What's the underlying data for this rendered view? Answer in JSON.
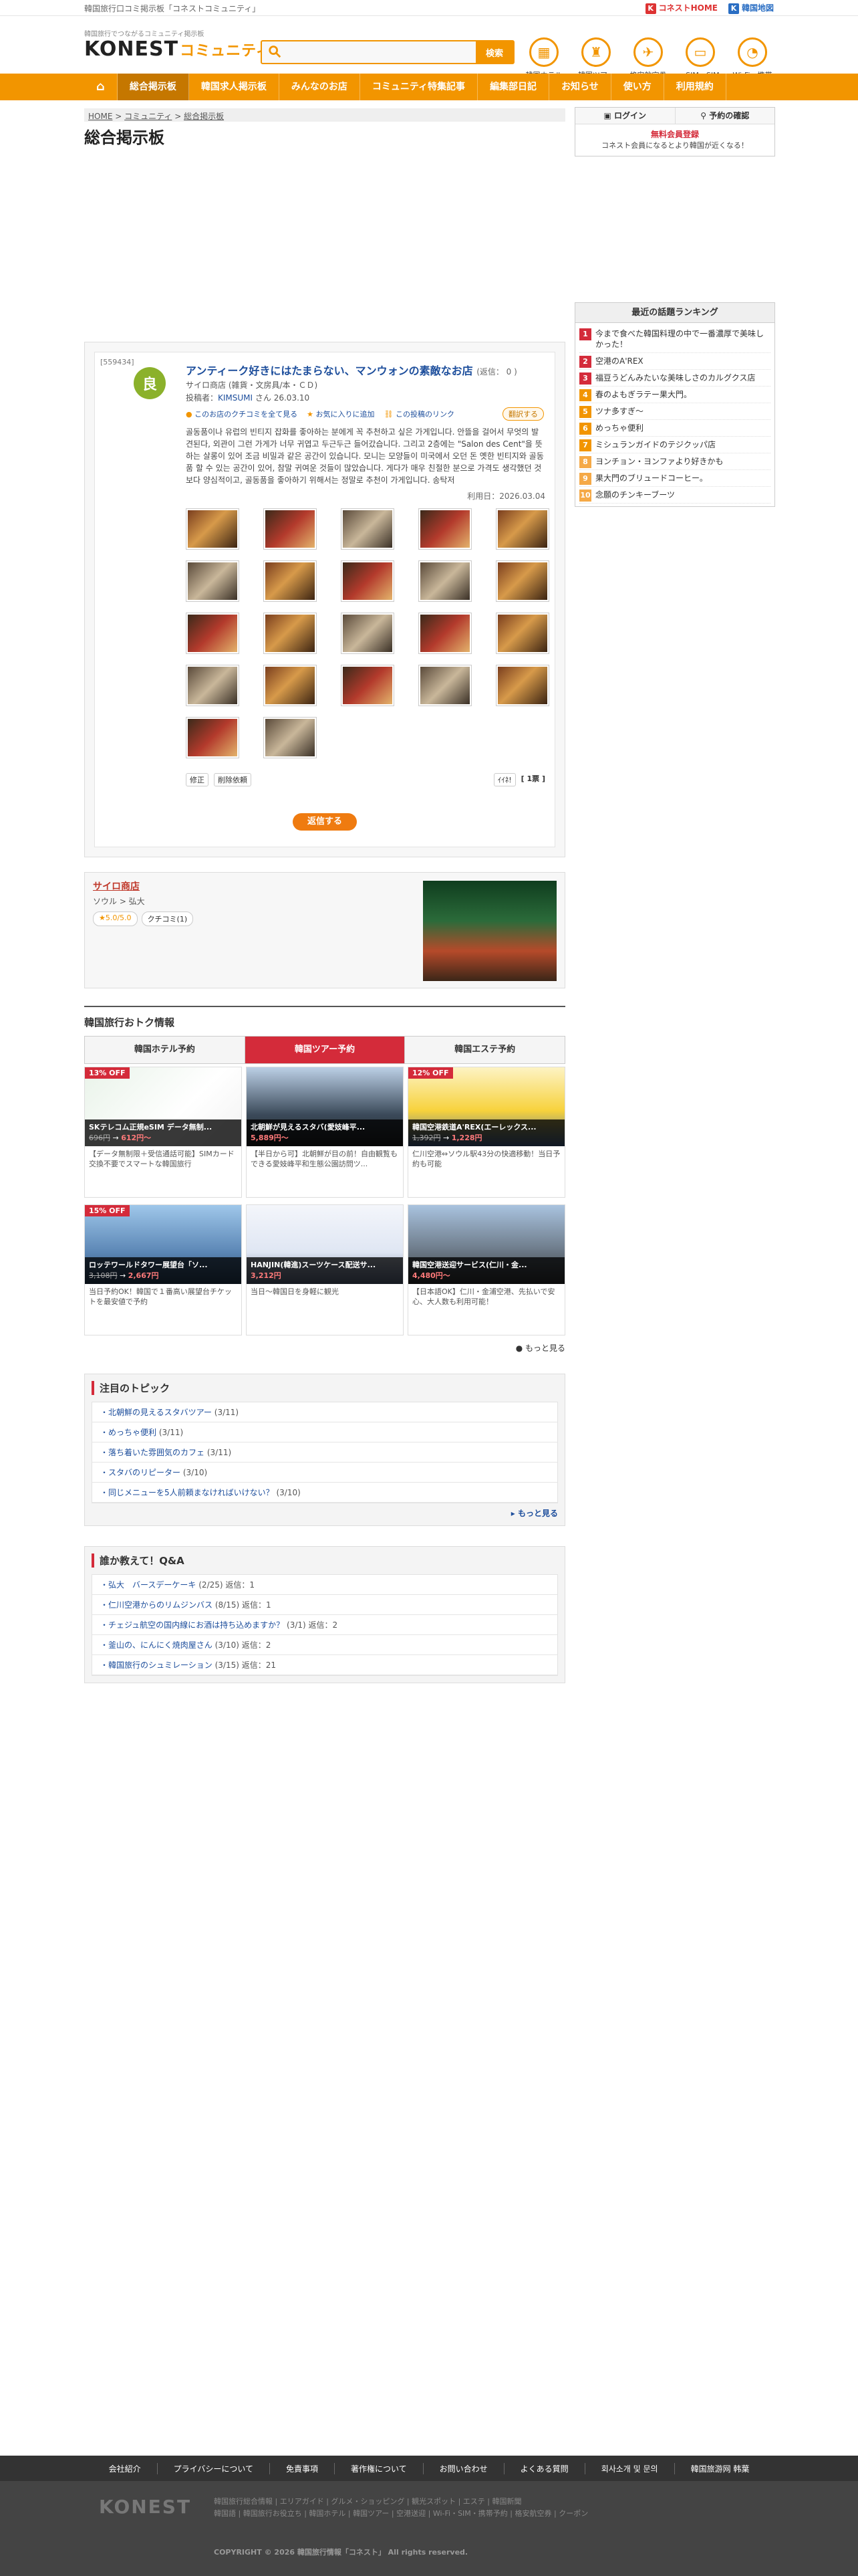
{
  "topbar": {
    "site_caption": "韓国旅行口コミ掲示板「コネストコミュニティ」",
    "link_konest": "コネストHOME",
    "link_map": "韓国地図"
  },
  "header": {
    "logo_tagline": "韓国旅行でつながるコミュニティ掲示板",
    "logo_main": "KONEST",
    "logo_sub": "コミュニティ",
    "search_placeholder": "",
    "search_button": "検索",
    "quick_links": [
      "韓国ホテル",
      "韓国ツアー",
      "格安航空券",
      "eSIM・SIM",
      "Wi-Fi・携帯"
    ]
  },
  "gnav": {
    "items": [
      "総合掲示板",
      "韓国求人掲示板",
      "みんなのお店",
      "コミュニティ特集記事",
      "編集部日記",
      "お知らせ",
      "使い方",
      "利用規約"
    ]
  },
  "breadcrumb": {
    "home": "HOME",
    "community": "コミュニティ",
    "current": "総合掲示板"
  },
  "page_title": "総合掲示板",
  "post": {
    "id": "[559434]",
    "grade": "良",
    "title": "アンティーク好きにはたまらない、マンウォンの素敵なお店",
    "reply_label": "(返信： 0 )",
    "shop_line": "サイロ商店 (雑貨・文房具/本・ＣＤ)",
    "poster_prefix": "投稿者：",
    "poster_name": "KIMSUMI",
    "poster_suffix": "さん 26.03.10",
    "action_all": "このお店のクチコミを全て見る",
    "action_fav": "お気に入りに追加",
    "action_url": "この投稿のリンク",
    "translate": "翻訳する",
    "body": "골동품이나 유럽의 빈티지 잡화를 좋아하는 분에게 꼭 추천하고 싶은 가게입니다. 안뜰을 걸어서 무엇의 발견된다, 외관이 그런 가게가 너무 귀엽고 두근두근 들어갔습니다. 그리고 2층에는 \"Salon des Cent\"을 뜻하는 살롱이 있어 조금 비밀과 같은 공간이 있습니다. 모니는 모양들이 미국에서 오던 돈 옛한 빈티지와 골동품 할 수 있는 공간이 있어, 참말 귀여운 것들이 많았습니다. 게다가 매우 친절한 분으로 가격도 생각했던 것보다 양심적이고, 골동품을 좋아하기 위해서는 정말로 추천이 가게입니다. 송탁저",
    "date": "利用日：2026.03.04",
    "edit": "修正",
    "delete": "削除依頼",
    "like_prefix": "ｲｲﾈ!",
    "like_count": "[ 1票 ]",
    "reply_button": "返信する"
  },
  "shop": {
    "name": "サイロ商店",
    "area": "ソウル > 弘大",
    "rating": "★5.0/5.0",
    "reviews": "クチコミ(1)"
  },
  "deals": {
    "heading": "韓国旅行おトク情報",
    "tabs": [
      "韓国ホテル予約",
      "韓国ツアー予約",
      "韓国エステ予約"
    ],
    "items": [
      {
        "off": "13% OFF",
        "title": "SKテレコム正規eSIM データ無制...",
        "old": "696円",
        "new": "612円～",
        "desc": "【データ無制限＋受信通話可能】SIMカード交換不要でスマートな韓国旅行"
      },
      {
        "off": "",
        "title": "北朝鮮が見えるスタバ(愛妓峰平...",
        "old": "",
        "new": "5,889円～",
        "desc": "【半日から可】北朝鮮が目の前！自由観覧もできる愛妓峰平和生態公園訪問ツ..."
      },
      {
        "off": "12% OFF",
        "title": "韓国空港鉄道A'REX(エーレックス...",
        "old": "1,392円",
        "new": "1,228円",
        "desc": "仁川空港⇔ソウル駅43分の快適移動！当日予約も可能"
      },
      {
        "off": "15% OFF",
        "title": "ロッテワールドタワー展望台「ソ...",
        "old": "3,108円",
        "new": "2,667円",
        "desc": "当日予約OK！韓国で１番高い展望台チケットを最安値で予約"
      },
      {
        "off": "",
        "title": "HANJIN(韓進)スーツケース配送サ...",
        "old": "",
        "new": "3,212円",
        "desc": "当日～韓国日を身軽に観光"
      },
      {
        "off": "",
        "title": "韓国空港送迎サービス(仁川・金...",
        "old": "",
        "new": "4,480円～",
        "desc": "【日本語OK】仁川・金浦空港、先払いで安心、大人数も利用可能！"
      }
    ],
    "more": "もっと見る"
  },
  "topics": {
    "heading": "注目のトピック",
    "items": [
      {
        "t": "北朝鮮の見えるスタバツアー",
        "n": "(3/11)"
      },
      {
        "t": "めっちゃ便利",
        "n": "(3/11)"
      },
      {
        "t": "落ち着いた雰囲気のカフェ",
        "n": "(3/11)"
      },
      {
        "t": "スタバのリピーター",
        "n": "(3/10)"
      },
      {
        "t": "同じメニューを5人前頼まなければいけない？",
        "n": "(3/10)"
      }
    ],
    "more": "もっと見る"
  },
  "qa": {
    "heading": "誰か教えて！Q&A",
    "items": [
      {
        "t": "弘大　バースデーケーキ",
        "n": "(2/25) 返信：1"
      },
      {
        "t": "仁川空港からのリムジンバス",
        "n": "(8/15) 返信：1"
      },
      {
        "t": "チェジュ航空の国内線にお酒は持ち込めますか？",
        "n": "(3/1) 返信：2"
      },
      {
        "t": "釜山の、にんにく焼肉屋さん",
        "n": "(3/10) 返信：2"
      },
      {
        "t": "韓国旅行のシュミレーション",
        "n": "(3/15) 返信：21"
      }
    ]
  },
  "side": {
    "login": "ログイン",
    "check": "予約の確認",
    "reg_title": "無料会員登録",
    "reg_text": "コネスト会員になるとより韓国が近くなる！",
    "rank_title": "最近の話題ランキング",
    "ranking": [
      "今まで食べた韓国料理の中で一番濃厚で美味しかった！",
      "空港のA'REX",
      "福豆うどんみたいな美味しさのカルグクス店",
      "春のよもぎラテー果大門。",
      "ツナ多すぎ～",
      "めっちゃ便利",
      "ミシュランガイドのテジクッパ店",
      "ヨンチョン・ヨンファより好きかも",
      "果大門のブリュードコーヒー。",
      "念願のチンキーブーツ"
    ]
  },
  "footer": {
    "nav": [
      "会社紹介",
      "プライバシーについて",
      "免責事項",
      "著作権について",
      "お問い合わせ",
      "よくある質問",
      "회사소개 및 문의",
      "韓国旅游网 韩葉"
    ],
    "logo": "KONEST",
    "line1": "韓国旅行総合情報  |  エリアガイド  |  グルメ・ショッピング  |  観光スポット  |  エステ  |  韓国新聞",
    "line2": "韓国語  |  韓国旅行お役立ち  |  韓国ホテル  |  韓国ツアー  |  空港送迎  |  Wi-Fi・SIM・携帯予約  |  格安航空券  |  クーポン",
    "copyright": "COPYRIGHT © 2026 韓国旅行情報「コネスト」 All rights reserved."
  }
}
